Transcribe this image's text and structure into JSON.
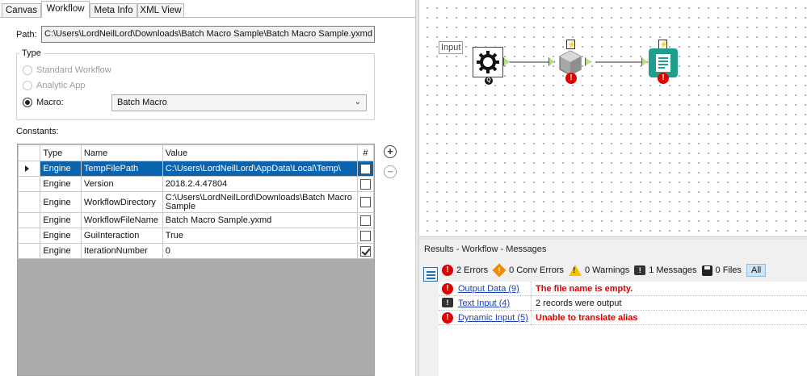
{
  "tabs": [
    "Canvas",
    "Workflow",
    "Meta Info",
    "XML View"
  ],
  "active_tab": "Workflow",
  "path": {
    "label": "Path:",
    "value": "C:\\Users\\LordNeilLord\\Downloads\\Batch Macro Sample\\Batch Macro Sample.yxmd"
  },
  "type_group": {
    "legend": "Type",
    "options": [
      {
        "label": "Standard Workflow",
        "enabled": false,
        "checked": false
      },
      {
        "label": "Analytic App",
        "enabled": false,
        "checked": false
      },
      {
        "label": "Macro:",
        "enabled": true,
        "checked": true
      }
    ],
    "macro_select_value": "Batch Macro"
  },
  "constants": {
    "label": "Constants:",
    "columns": [
      "Type",
      "Name",
      "Value",
      "#"
    ],
    "rows": [
      {
        "type": "Engine",
        "name": "TempFilePath",
        "value": "C:\\Users\\LordNeilLord\\AppData\\Local\\Temp\\",
        "checked": false,
        "selected": true
      },
      {
        "type": "Engine",
        "name": "Version",
        "value": "2018.2.4.47804",
        "checked": false,
        "selected": false
      },
      {
        "type": "Engine",
        "name": "WorkflowDirectory",
        "value": "C:\\Users\\LordNeilLord\\Downloads\\Batch Macro Sample",
        "checked": false,
        "selected": false
      },
      {
        "type": "Engine",
        "name": "WorkflowFileName",
        "value": "Batch Macro Sample.yxmd",
        "checked": false,
        "selected": false
      },
      {
        "type": "Engine",
        "name": "GuiInteraction",
        "value": "True",
        "checked": false,
        "selected": false
      },
      {
        "type": "Engine",
        "name": "IterationNumber",
        "value": "0",
        "checked": true,
        "selected": false
      }
    ]
  },
  "canvas": {
    "input_label": "Input",
    "tools": [
      {
        "name": "control-parameter-tool",
        "color": "#222222"
      },
      {
        "name": "dynamic-input-tool",
        "color": "#8a8a8a",
        "error": true
      },
      {
        "name": "output-tool",
        "color": "#1f9e8c",
        "error": true
      }
    ]
  },
  "results": {
    "title": "Results - Workflow - Messages",
    "toolbar": {
      "errors": "2 Errors",
      "conv_errors": "0 Conv Errors",
      "warnings": "0 Warnings",
      "messages": "1 Messages",
      "files": "0 Files",
      "all": "All"
    },
    "messages": [
      {
        "icon": "error",
        "tool": "Output Data (9)",
        "text": "The file name is empty."
      },
      {
        "icon": "message",
        "tool": "Text Input (4)",
        "text": "2 records were output"
      },
      {
        "icon": "error",
        "tool": "Dynamic Input (5)",
        "text": "Unable to translate alias"
      }
    ]
  },
  "colors": {
    "selection": "#0a64ad",
    "error": "#e00000",
    "link": "#1a3fb8",
    "accent_teal": "#1f9e8c"
  }
}
